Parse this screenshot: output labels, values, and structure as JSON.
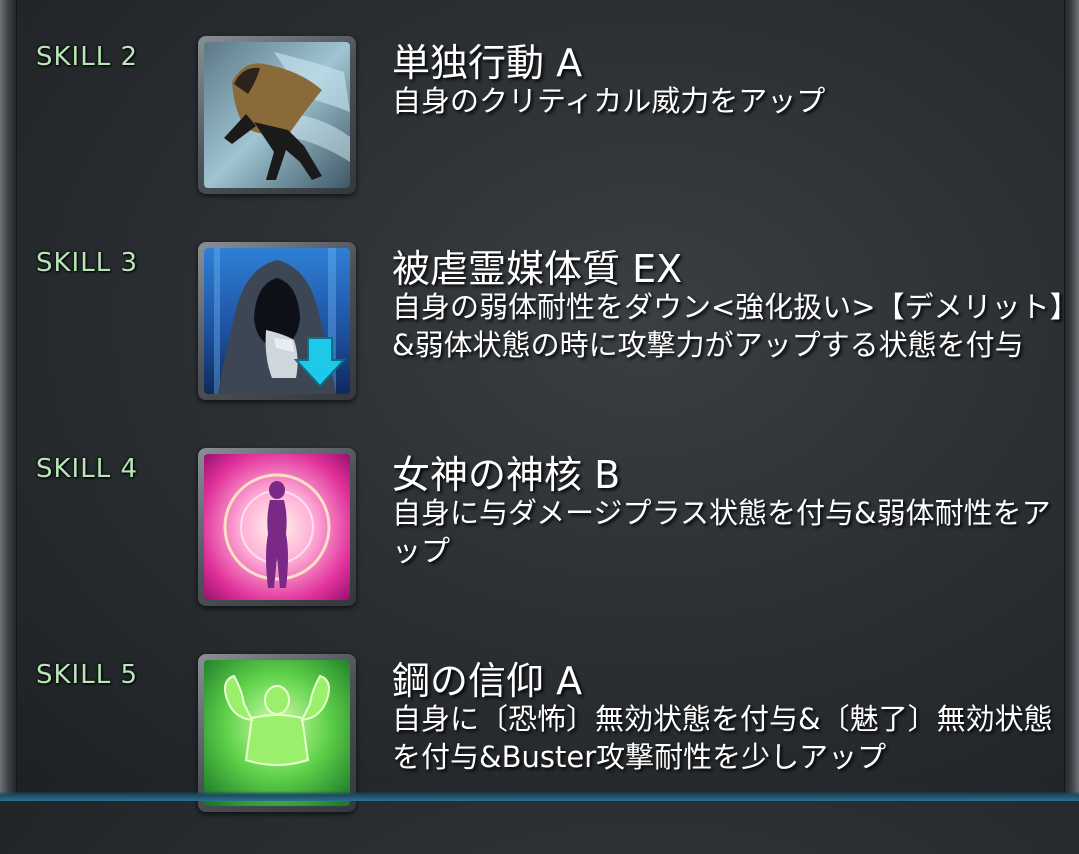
{
  "colors": {
    "skill_tag": "#b8e6b8",
    "text": "#ffffff",
    "background": "#2c3034"
  },
  "skills": [
    {
      "tag": "SKILL 2",
      "name": "単独行動 A",
      "description": "自身のクリティカル威力をアップ",
      "icon": "hooded-runner-icon"
    },
    {
      "tag": "SKILL 3",
      "name": "被虐霊媒体質 EX",
      "description": "自身の弱体耐性をダウン<強化扱い>【デメリット】&弱体状態の時に攻撃力がアップする状態を付与",
      "icon": "hooded-figure-debuff-down-arrow-icon"
    },
    {
      "tag": "SKILL 4",
      "name": "女神の神核 B",
      "description": "自身に与ダメージプラス状態を付与&弱体耐性をアップ",
      "icon": "goddess-silhouette-radiant-icon"
    },
    {
      "tag": "SKILL 5",
      "name": "鋼の信仰 A",
      "description": "自身に〔恐怖〕無効状態を付与&〔魅了〕無効状態を付与&Buster攻撃耐性を少しアップ",
      "icon": "flexing-figure-green-icon"
    }
  ]
}
